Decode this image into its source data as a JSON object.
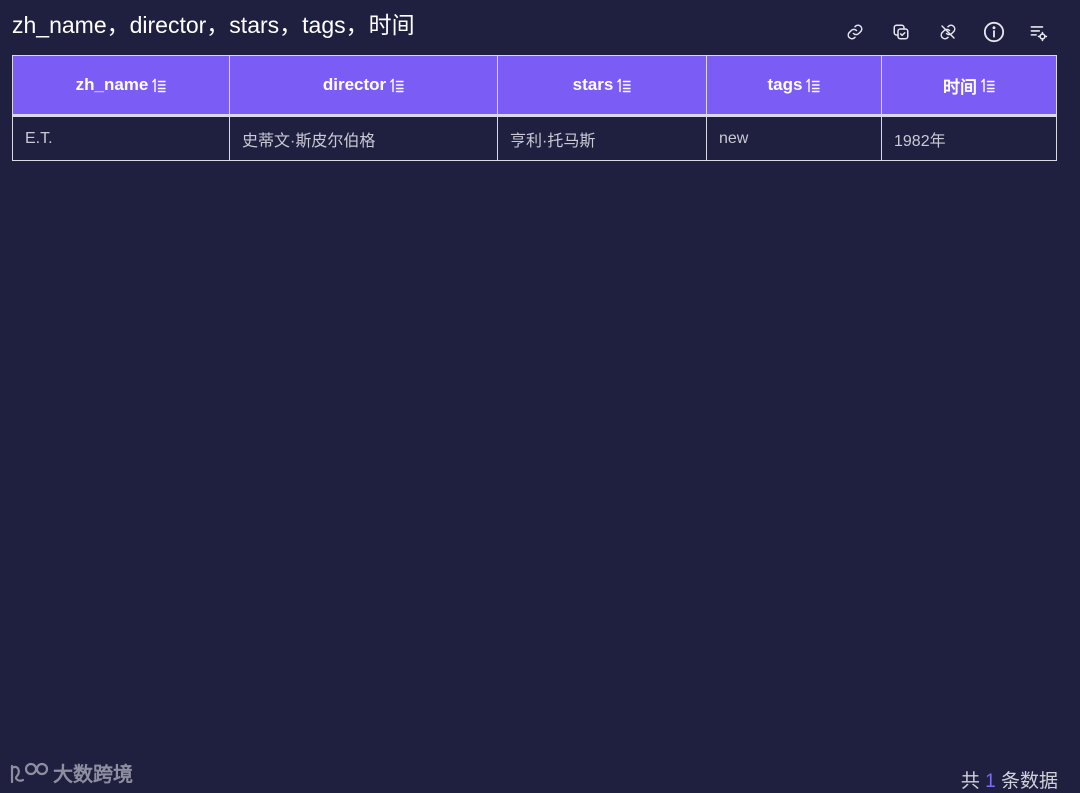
{
  "title": "zh_name，director，stars，tags，时间",
  "toolbar": {
    "icons": [
      "link-icon",
      "copy-icon",
      "unlink-icon",
      "info-icon",
      "list-settings-icon"
    ]
  },
  "table": {
    "columns": [
      "zh_name",
      "director",
      "stars",
      "tags",
      "时间"
    ],
    "rows": [
      [
        "E.T.",
        "史蒂文·斯皮尔伯格",
        "亨利·托马斯",
        "new",
        "1982年"
      ]
    ]
  },
  "footer": {
    "brand": "大数跨境",
    "count_prefix": "共",
    "count": "1",
    "count_suffix": "条数据"
  },
  "colors": {
    "background": "#1f2040",
    "header": "#7b5cf5",
    "accent": "#7b6cf6"
  }
}
